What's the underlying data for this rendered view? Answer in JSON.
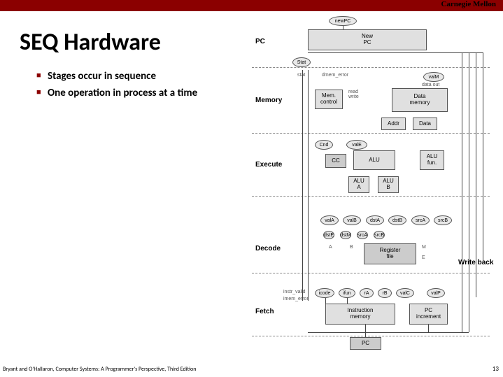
{
  "brand": "Carnegie Mellon",
  "title": "SEQ Hardware",
  "bullets": [
    "Stages occur in sequence",
    "One operation in process at a time"
  ],
  "footer_left": "Bryant and O'Hallaron, Computer Systems: A Programmer's Perspective, Third Edition",
  "footer_right": "13",
  "diagram": {
    "stages": {
      "pc": "PC",
      "memory": "Memory",
      "execute": "Execute",
      "decode": "Decode",
      "writeback": "Write back",
      "fetch": "Fetch"
    },
    "blocks": {
      "newpc_oval": "newPC",
      "new_pc": "New\nPC",
      "stat_oval": "Stat",
      "stat_label": "stat",
      "dmem_error": "dmem_error",
      "valm": "valM",
      "data_out": "data out",
      "mem_control": "Mem.\ncontrol",
      "read_write": "read\nwrite",
      "data_memory": "Data\nmemory",
      "addr": "Addr",
      "data": "Data",
      "cnd": "Cnd",
      "vale": "valE",
      "cc": "CC",
      "alu": "ALU",
      "alu_fun": "ALU\nfun.",
      "alu_a": "ALU\nA",
      "alu_b": "ALU\nB",
      "vala": "valA",
      "valb": "valB",
      "dsta": "dstA",
      "dstb": "dstB",
      "srca": "srcA",
      "srcB": "srcB",
      "a": "A",
      "b": "B",
      "register_file": "Register\nfile",
      "m": "M",
      "e": "E",
      "instr_valid": "instr_valid",
      "imem_error": "imem_error",
      "icode": "icode",
      "ifun": "ifun",
      "ra": "rA",
      "rb": "rB",
      "valc": "valC",
      "valp": "valP",
      "instruction_memory": "Instruction\nmemory",
      "pc_increment": "PC\nincrement",
      "pc": "PC"
    }
  }
}
